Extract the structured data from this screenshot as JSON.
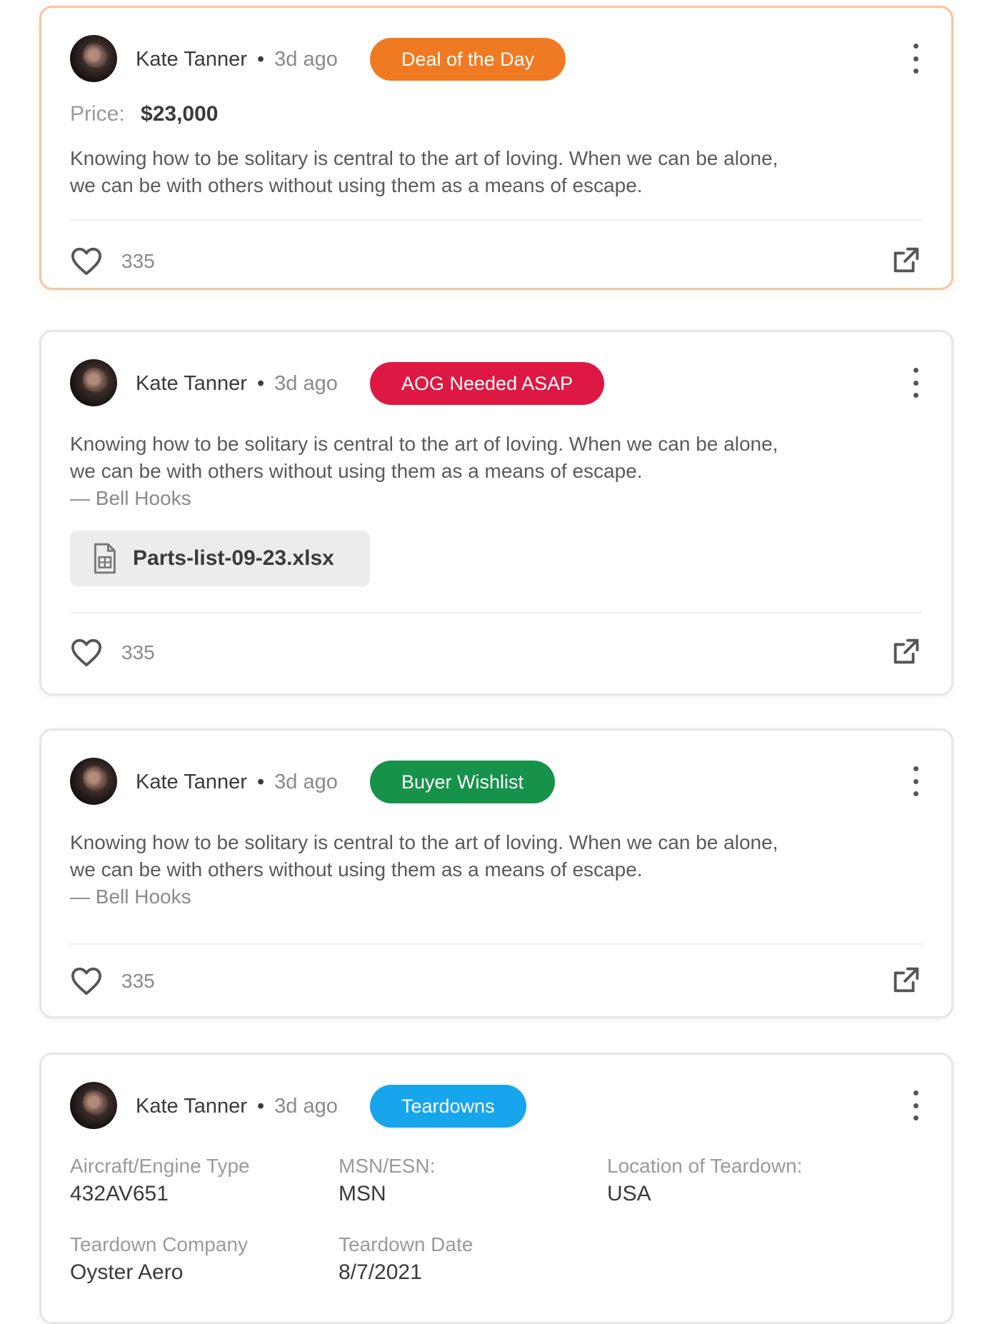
{
  "colors": {
    "deal_badge": "#ef7a22",
    "aog_badge": "#dd1843",
    "wishlist_badge": "#16924a",
    "teardown_badge": "#17a5ec",
    "highlight_border": "#f7c4a4"
  },
  "posts": [
    {
      "author": "Kate Tanner",
      "separator": "•",
      "time": "3d ago",
      "badge": "Deal of the Day",
      "price_label": "Price:",
      "price_value": "$23,000",
      "text_line1": "Knowing how to be solitary is central to the art of loving. When we can be alone,",
      "text_line2": "we can be with others without using them as a means of escape.",
      "likes": "335",
      "icons": {
        "like": "heart-icon",
        "share": "share-icon",
        "menu": "more-vertical-icon"
      }
    },
    {
      "author": "Kate Tanner",
      "separator": "•",
      "time": "3d ago",
      "badge": "AOG Needed ASAP",
      "text_line1": "Knowing how to be solitary is central to the art of loving. When we can be alone,",
      "text_line2": "we can be with others without using them as a means of escape.",
      "text_author": "— Bell Hooks",
      "attachment": "Parts-list-09-23.xlsx",
      "likes": "335",
      "icons": {
        "like": "heart-icon",
        "share": "share-icon",
        "menu": "more-vertical-icon",
        "file": "file-icon"
      }
    },
    {
      "author": "Kate Tanner",
      "separator": "•",
      "time": "3d ago",
      "badge": "Buyer Wishlist",
      "text_line1": "Knowing how to be solitary is central to the art of loving. When we can be alone,",
      "text_line2": "we can be with others without using them as a means of escape.",
      "text_author": "— Bell Hooks",
      "likes": "335",
      "icons": {
        "like": "heart-icon",
        "share": "share-icon",
        "menu": "more-vertical-icon"
      }
    },
    {
      "author": "Kate Tanner",
      "separator": "•",
      "time": "3d ago",
      "badge": "Teardowns",
      "fields": [
        {
          "label": "Aircraft/Engine Type",
          "value": "432AV651"
        },
        {
          "label": "MSN/ESN:",
          "value": "MSN"
        },
        {
          "label": "Location of Teardown:",
          "value": "USA"
        },
        {
          "label": "Teardown Company",
          "value": "Oyster Aero"
        },
        {
          "label": "Teardown Date",
          "value": "8/7/2021"
        }
      ],
      "icons": {
        "menu": "more-vertical-icon"
      }
    }
  ]
}
